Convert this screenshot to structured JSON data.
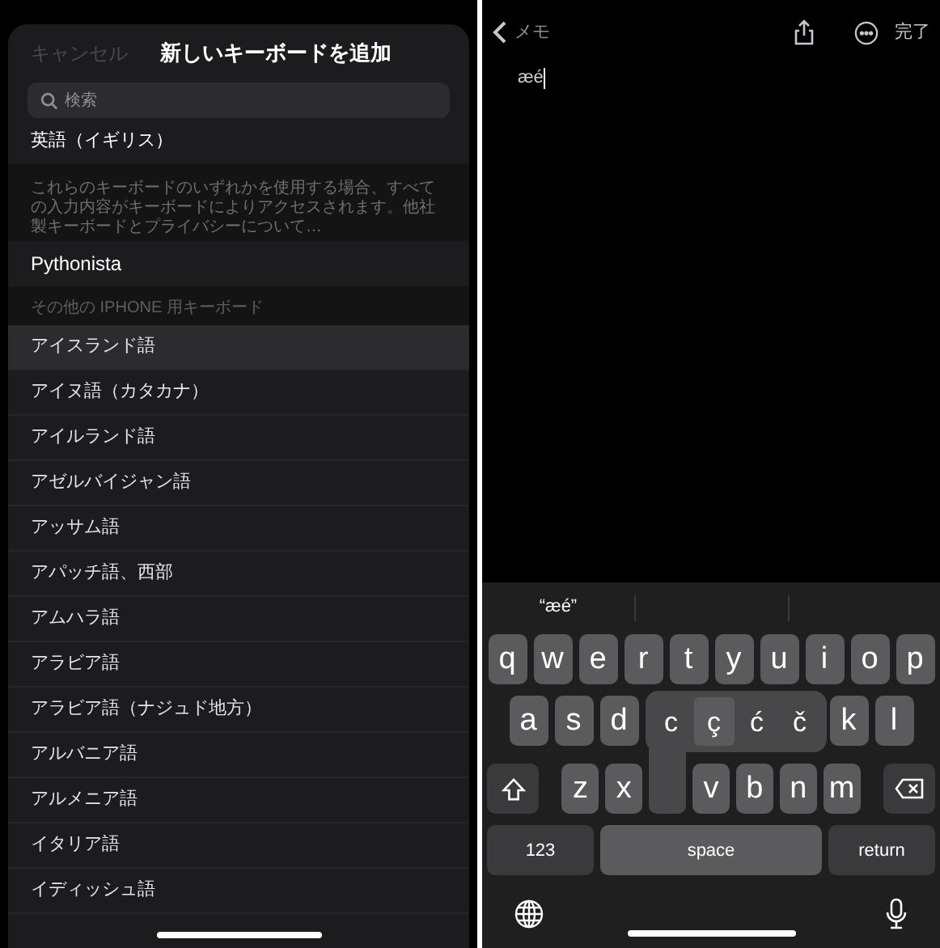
{
  "add_keyboard_sheet": {
    "cancel": "キャンセル",
    "title": "新しいキーボードを追加",
    "search": {
      "placeholder": "検索"
    },
    "top_row": "英語（イギリス）",
    "third_party_note": "これらのキーボードのいずれかを使用する場合、すべての入力内容がキーボードによりアクセスされます。他社製キーボードとプライバシーについて…",
    "third_party_items": [
      "Pythonista"
    ],
    "section_header": "その他の IPHONE 用キーボード",
    "items": [
      {
        "label": "アイスランド語",
        "selected": true
      },
      {
        "label": "アイヌ語（カタカナ）",
        "selected": false
      },
      {
        "label": "アイルランド語",
        "selected": false
      },
      {
        "label": "アゼルバイジャン語",
        "selected": false
      },
      {
        "label": "アッサム語",
        "selected": false
      },
      {
        "label": "アパッチ語、西部",
        "selected": false
      },
      {
        "label": "アムハラ語",
        "selected": false
      },
      {
        "label": "アラビア語",
        "selected": false
      },
      {
        "label": "アラビア語（ナジュド地方）",
        "selected": false
      },
      {
        "label": "アルバニア語",
        "selected": false
      },
      {
        "label": "アルメニア語",
        "selected": false
      },
      {
        "label": "イタリア語",
        "selected": false
      },
      {
        "label": "イディッシュ語",
        "selected": false
      }
    ]
  },
  "notes_editor": {
    "back": "メモ",
    "done": "完了",
    "text": "æé",
    "keyboard": {
      "suggestion": "“æé”",
      "row1": [
        "q",
        "w",
        "e",
        "r",
        "t",
        "y",
        "u",
        "i",
        "o",
        "p"
      ],
      "row2_left": [
        "a",
        "s",
        "d"
      ],
      "row2_right": [
        "k",
        "l"
      ],
      "row3": [
        "z",
        "x",
        "v",
        "b",
        "n",
        "m"
      ],
      "accent_popup": [
        {
          "label": "c",
          "selected": false
        },
        {
          "label": "ç",
          "selected": true
        },
        {
          "label": "ć",
          "selected": false
        },
        {
          "label": "č",
          "selected": false
        }
      ],
      "numbers": "123",
      "space": "space",
      "return": "return"
    }
  }
}
